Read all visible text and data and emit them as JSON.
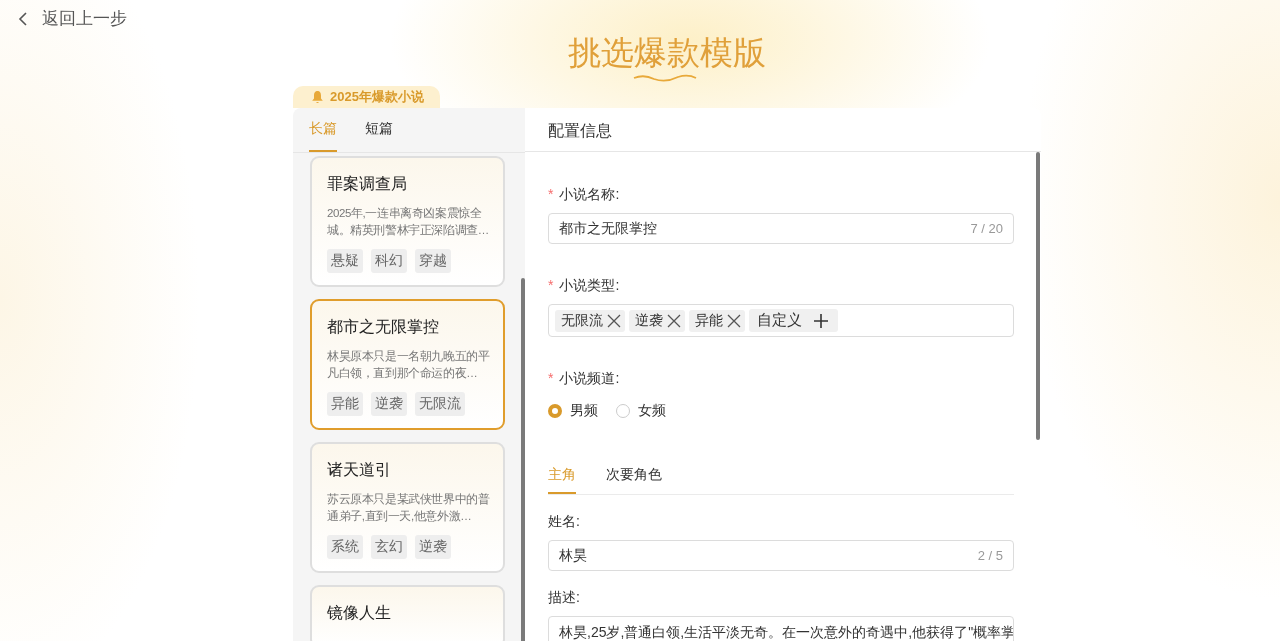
{
  "back": {
    "label": "返回上一步"
  },
  "title": "挑选爆款模版",
  "badge": "2025年爆款小说",
  "length_tabs": [
    {
      "label": "长篇",
      "selected": true
    },
    {
      "label": "短篇",
      "selected": false
    }
  ],
  "cards": [
    {
      "title": "罪案调查局",
      "description": "2025年,一连串离奇凶案震惊全城。精英刑警林宇正深陷调查…",
      "tags": [
        "悬疑",
        "科幻",
        "穿越"
      ],
      "selected": false
    },
    {
      "title": "都市之无限掌控",
      "description": "林昊原本只是一名朝九晚五的平凡白领，直到那个命运的夜…",
      "tags": [
        "异能",
        "逆袭",
        "无限流"
      ],
      "selected": true
    },
    {
      "title": "诸天道引",
      "description": "苏云原本只是某武侠世界中的普通弟子,直到一天,他意外激…",
      "tags": [
        "系统",
        "玄幻",
        "逆袭"
      ],
      "selected": false
    },
    {
      "title": "镜像人生",
      "selected": false
    }
  ],
  "config": {
    "header": "配置信息",
    "required_mark": "*",
    "name_field": {
      "label": "小说名称:",
      "required": true,
      "value": "都市之无限掌控",
      "count": "7 / 20"
    },
    "type_field": {
      "label": "小说类型:",
      "required": true,
      "tags": [
        "无限流",
        "逆袭",
        "异能"
      ],
      "custom_label": "自定义"
    },
    "channel_field": {
      "label": "小说频道:",
      "required": true,
      "options": [
        {
          "label": "男频",
          "selected": true
        },
        {
          "label": "女频",
          "selected": false
        }
      ]
    },
    "role_tabs": [
      {
        "label": "主角",
        "selected": true
      },
      {
        "label": "次要角色",
        "selected": false
      }
    ],
    "role_name": {
      "label": "姓名:",
      "value": "林昊",
      "count": "2 / 5"
    },
    "role_description": {
      "label": "描述:",
      "value": "林昊,25岁,普通白领,生活平淡无奇。在一次意外的奇遇中,他获得了\"概率掌"
    }
  }
}
